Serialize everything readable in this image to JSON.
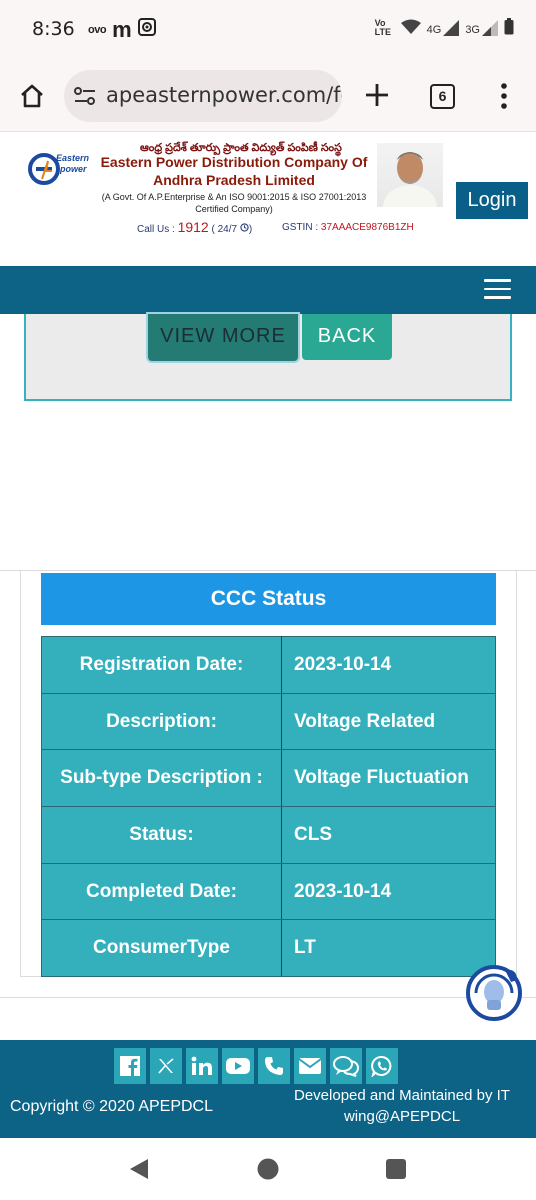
{
  "status_bar": {
    "time": "8:36",
    "left_icons": [
      "ovo-icon",
      "m-app-icon",
      "camera-app-icon"
    ],
    "right_icons": [
      "volte-icon",
      "wifi-icon",
      "4g-signal-icon",
      "3g-signal-icon",
      "battery-icon"
    ],
    "net1": "4G",
    "net2": "3G",
    "volte": "Vo LTE"
  },
  "browser": {
    "url": "apeasternpower.com/fo",
    "tab_count": "6"
  },
  "site_header": {
    "telugu_title": "ఆంధ్ర ప్రదేశ్ తూర్పు ప్రాంత విద్యుత్ పంపిణీ సంస్థ",
    "company_name": "Eastern Power Distribution Company Of Andhra Pradesh Limited",
    "govt_line": "(A Govt. Of A.P.Enterprise & An ISO 9001:2015 & ISO 27001:2013 Certified Company)",
    "call_label": "Call Us : ",
    "call_number": "1912",
    "call_hours": " ( 24/7 ",
    "call_hours_end": ")",
    "gstin_label": "GSTIN : ",
    "gstin_value": "37AAACE9876B1ZH",
    "login_label": "Login",
    "logo_text_1": "Eastern",
    "logo_text_2": "power"
  },
  "actions": {
    "view_more": "VIEW MORE",
    "back": "BACK"
  },
  "ccc": {
    "title": "CCC Status",
    "rows": [
      {
        "label": "Registration Date:",
        "value": "2023-10-14"
      },
      {
        "label": "Description:",
        "value": "Voltage Related"
      },
      {
        "label": "Sub-type Description :",
        "value": "Voltage Fluctuation"
      },
      {
        "label": "Status:",
        "value": "CLS"
      },
      {
        "label": "Completed Date:",
        "value": "2023-10-14"
      },
      {
        "label": "ConsumerType",
        "value": "LT"
      }
    ]
  },
  "footer": {
    "social_icons": [
      "facebook-icon",
      "x-icon",
      "linkedin-icon",
      "youtube-icon",
      "phone-icon",
      "email-icon",
      "chat-icon",
      "whatsapp-icon"
    ],
    "copyright": "Copyright © 2020 APEPDCL",
    "developed": "Developed and Maintained by IT wing@APEPDCL"
  },
  "colors": {
    "nav": "#0c6386",
    "ccc_header": "#1e96e6",
    "table_bg": "#33b0bc",
    "login": "#0a5f88"
  }
}
